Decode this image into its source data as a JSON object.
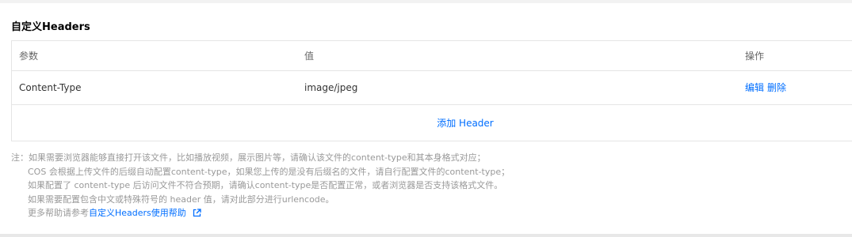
{
  "section": {
    "title": "自定义Headers"
  },
  "table": {
    "columns": [
      "参数",
      "值",
      "操作"
    ],
    "rows": [
      {
        "param": "Content-Type",
        "value": "image/jpeg",
        "actions": [
          "编辑",
          "删除"
        ]
      }
    ],
    "add_label": "添加 Header"
  },
  "notes": {
    "line1": "注：如果需要浏览器能够直接打开该文件，比如播放视频，展示图片等，请确认该文件的content-type和其本身格式对应；",
    "line2": "COS 会根据上传文件的后缀自动配置content-type，如果您上传的是没有后缀名的文件，请自行配置文件的content-type；",
    "line3": "如果配置了 content-type 后访问文件不符合预期，请确认content-type是否配置正常，或者浏览器是否支持该格式文件。",
    "line4": "如果需要配置包含中文或特殊符号的 header 值，请对此部分进行urlencode。",
    "line5_prefix": "更多帮助请参考",
    "help_link": "自定义Headers使用帮助"
  },
  "colors": {
    "link": "#006eff",
    "muted": "#999999",
    "border": "#e5e5e5"
  },
  "icons": {
    "help_link_icon": "external-link-icon"
  }
}
